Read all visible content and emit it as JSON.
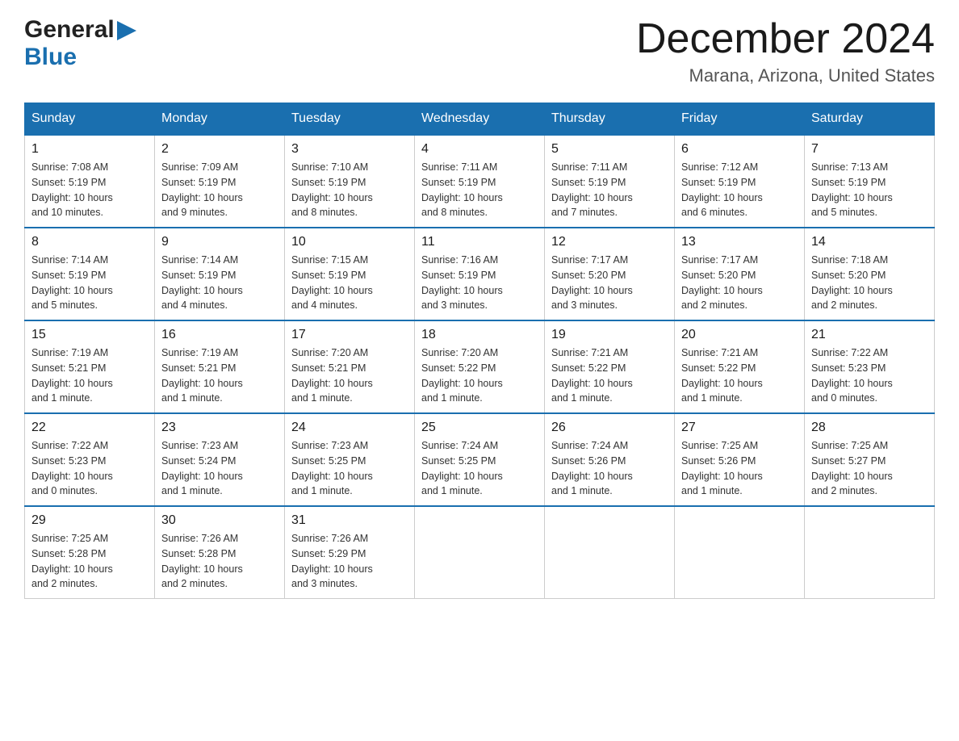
{
  "header": {
    "logo_general": "General",
    "logo_blue": "Blue",
    "month_title": "December 2024",
    "location": "Marana, Arizona, United States"
  },
  "weekdays": [
    "Sunday",
    "Monday",
    "Tuesday",
    "Wednesday",
    "Thursday",
    "Friday",
    "Saturday"
  ],
  "weeks": [
    [
      {
        "day": "1",
        "sunrise": "7:08 AM",
        "sunset": "5:19 PM",
        "daylight": "10 hours and 10 minutes."
      },
      {
        "day": "2",
        "sunrise": "7:09 AM",
        "sunset": "5:19 PM",
        "daylight": "10 hours and 9 minutes."
      },
      {
        "day": "3",
        "sunrise": "7:10 AM",
        "sunset": "5:19 PM",
        "daylight": "10 hours and 8 minutes."
      },
      {
        "day": "4",
        "sunrise": "7:11 AM",
        "sunset": "5:19 PM",
        "daylight": "10 hours and 8 minutes."
      },
      {
        "day": "5",
        "sunrise": "7:11 AM",
        "sunset": "5:19 PM",
        "daylight": "10 hours and 7 minutes."
      },
      {
        "day": "6",
        "sunrise": "7:12 AM",
        "sunset": "5:19 PM",
        "daylight": "10 hours and 6 minutes."
      },
      {
        "day": "7",
        "sunrise": "7:13 AM",
        "sunset": "5:19 PM",
        "daylight": "10 hours and 5 minutes."
      }
    ],
    [
      {
        "day": "8",
        "sunrise": "7:14 AM",
        "sunset": "5:19 PM",
        "daylight": "10 hours and 5 minutes."
      },
      {
        "day": "9",
        "sunrise": "7:14 AM",
        "sunset": "5:19 PM",
        "daylight": "10 hours and 4 minutes."
      },
      {
        "day": "10",
        "sunrise": "7:15 AM",
        "sunset": "5:19 PM",
        "daylight": "10 hours and 4 minutes."
      },
      {
        "day": "11",
        "sunrise": "7:16 AM",
        "sunset": "5:19 PM",
        "daylight": "10 hours and 3 minutes."
      },
      {
        "day": "12",
        "sunrise": "7:17 AM",
        "sunset": "5:20 PM",
        "daylight": "10 hours and 3 minutes."
      },
      {
        "day": "13",
        "sunrise": "7:17 AM",
        "sunset": "5:20 PM",
        "daylight": "10 hours and 2 minutes."
      },
      {
        "day": "14",
        "sunrise": "7:18 AM",
        "sunset": "5:20 PM",
        "daylight": "10 hours and 2 minutes."
      }
    ],
    [
      {
        "day": "15",
        "sunrise": "7:19 AM",
        "sunset": "5:21 PM",
        "daylight": "10 hours and 1 minute."
      },
      {
        "day": "16",
        "sunrise": "7:19 AM",
        "sunset": "5:21 PM",
        "daylight": "10 hours and 1 minute."
      },
      {
        "day": "17",
        "sunrise": "7:20 AM",
        "sunset": "5:21 PM",
        "daylight": "10 hours and 1 minute."
      },
      {
        "day": "18",
        "sunrise": "7:20 AM",
        "sunset": "5:22 PM",
        "daylight": "10 hours and 1 minute."
      },
      {
        "day": "19",
        "sunrise": "7:21 AM",
        "sunset": "5:22 PM",
        "daylight": "10 hours and 1 minute."
      },
      {
        "day": "20",
        "sunrise": "7:21 AM",
        "sunset": "5:22 PM",
        "daylight": "10 hours and 1 minute."
      },
      {
        "day": "21",
        "sunrise": "7:22 AM",
        "sunset": "5:23 PM",
        "daylight": "10 hours and 0 minutes."
      }
    ],
    [
      {
        "day": "22",
        "sunrise": "7:22 AM",
        "sunset": "5:23 PM",
        "daylight": "10 hours and 0 minutes."
      },
      {
        "day": "23",
        "sunrise": "7:23 AM",
        "sunset": "5:24 PM",
        "daylight": "10 hours and 1 minute."
      },
      {
        "day": "24",
        "sunrise": "7:23 AM",
        "sunset": "5:25 PM",
        "daylight": "10 hours and 1 minute."
      },
      {
        "day": "25",
        "sunrise": "7:24 AM",
        "sunset": "5:25 PM",
        "daylight": "10 hours and 1 minute."
      },
      {
        "day": "26",
        "sunrise": "7:24 AM",
        "sunset": "5:26 PM",
        "daylight": "10 hours and 1 minute."
      },
      {
        "day": "27",
        "sunrise": "7:25 AM",
        "sunset": "5:26 PM",
        "daylight": "10 hours and 1 minute."
      },
      {
        "day": "28",
        "sunrise": "7:25 AM",
        "sunset": "5:27 PM",
        "daylight": "10 hours and 2 minutes."
      }
    ],
    [
      {
        "day": "29",
        "sunrise": "7:25 AM",
        "sunset": "5:28 PM",
        "daylight": "10 hours and 2 minutes."
      },
      {
        "day": "30",
        "sunrise": "7:26 AM",
        "sunset": "5:28 PM",
        "daylight": "10 hours and 2 minutes."
      },
      {
        "day": "31",
        "sunrise": "7:26 AM",
        "sunset": "5:29 PM",
        "daylight": "10 hours and 3 minutes."
      },
      null,
      null,
      null,
      null
    ]
  ],
  "labels": {
    "sunrise": "Sunrise:",
    "sunset": "Sunset:",
    "daylight": "Daylight:"
  }
}
